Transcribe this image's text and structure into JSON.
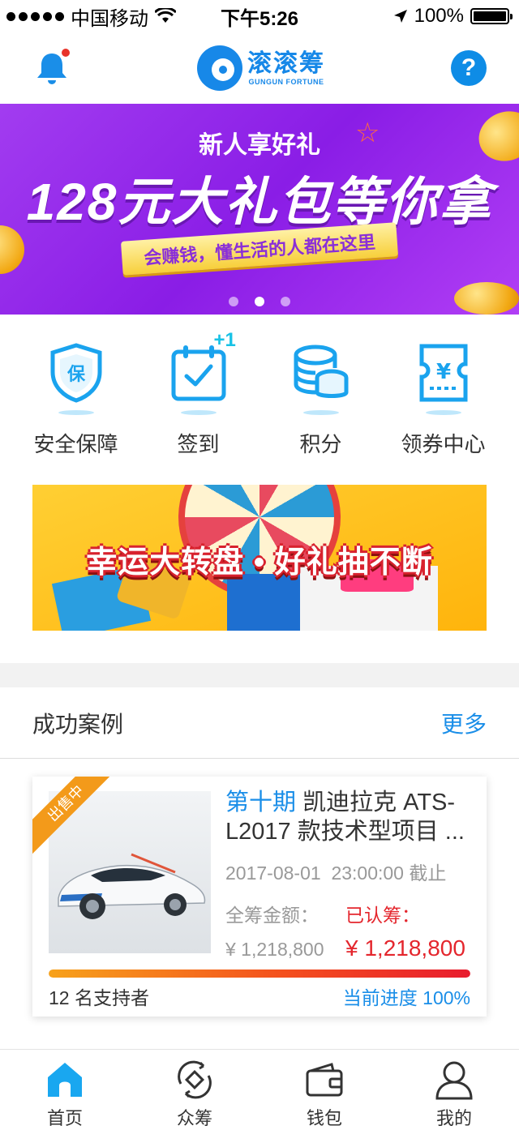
{
  "status_bar": {
    "carrier": "中国移动",
    "time": "下午5:26",
    "battery": "100%"
  },
  "header": {
    "logo_cn": "滚滚筹",
    "logo_en": "GUNGUN FORTUNE",
    "help_symbol": "?",
    "icons": [
      "bell-icon",
      "question-icon"
    ]
  },
  "banner": {
    "subtitle": "新人享好礼",
    "headline": "128元大礼包等你拿",
    "tagline": "会赚钱，懂生活的人都在这里",
    "pages": 3,
    "active_page": 2
  },
  "quick_entries": [
    {
      "label": "安全保障",
      "icon": "shield-icon"
    },
    {
      "label": "签到",
      "icon": "calendar-check-icon",
      "badge": "+1"
    },
    {
      "label": "积分",
      "icon": "coins-icon"
    },
    {
      "label": "领券中心",
      "icon": "coupon-icon"
    }
  ],
  "promo": {
    "title": "幸运大转盘 • 好礼抽不断"
  },
  "cases": {
    "title": "成功案例",
    "more": "更多",
    "items": [
      {
        "ribbon": "出售中",
        "period": "第十期",
        "name": " 凯迪拉克 ATS-L2017 款技术型项目 ...",
        "date": "2017-08-01",
        "deadline": "23:00:00 截止",
        "total_label": "全筹金额：",
        "total": "¥ 1,218,800",
        "subscribed_label": "已认筹：",
        "subscribed": "¥ 1,218,800",
        "progress": 1.0,
        "supporters": "12 名支持者",
        "progress_text": "当前进度 100%"
      }
    ]
  },
  "tabbar": [
    {
      "label": "首页",
      "icon": "home-icon",
      "active": true
    },
    {
      "label": "众筹",
      "icon": "crowdfund-icon",
      "active": false
    },
    {
      "label": "钱包",
      "icon": "wallet-icon",
      "active": false
    },
    {
      "label": "我的",
      "icon": "user-icon",
      "active": false
    }
  ],
  "colors": {
    "brand_blue": "#1a8ee8",
    "price_red": "#e4262d",
    "banner_purple": "#9b2ef0"
  }
}
